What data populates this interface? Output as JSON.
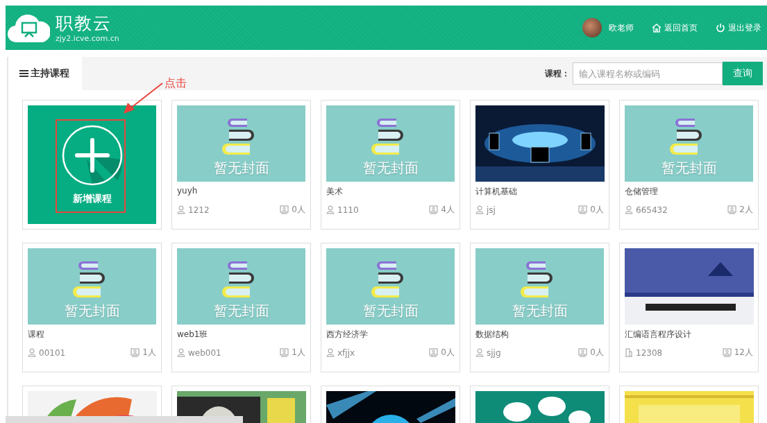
{
  "header": {
    "logo_title": "职教云",
    "logo_subtitle": "zjy2.icve.com.cn",
    "user": "欧老师",
    "links": [
      {
        "kind": "home",
        "label": "返回首页"
      },
      {
        "kind": "logout",
        "label": "退出登录"
      }
    ]
  },
  "tabs": [
    {
      "label": "主持课程",
      "selected": true
    }
  ],
  "search": {
    "label": "课程：",
    "placeholder": "输入课程名称或编码",
    "button": "查询"
  },
  "annotation": {
    "label": "点击"
  },
  "cards": [
    {
      "kind": "add",
      "label": "新增课程"
    },
    {
      "kind": "course",
      "cover": {
        "kind": "placeholder",
        "text": "暂无封面"
      },
      "title": "yuyh",
      "owner": {
        "kind": "person",
        "text": "1212"
      },
      "count": "0人"
    },
    {
      "kind": "course",
      "cover": {
        "kind": "placeholder",
        "text": "暂无封面"
      },
      "title": "美术",
      "owner": {
        "kind": "person",
        "text": "1110"
      },
      "count": "4人"
    },
    {
      "kind": "course",
      "title": "计算机基础",
      "owner": {
        "kind": "person",
        "text": "jsj"
      },
      "count": "0人"
    },
    {
      "kind": "course",
      "cover": {
        "kind": "placeholder",
        "text": "暂无封面"
      },
      "title": "仓储管理",
      "owner": {
        "kind": "person",
        "text": "665432"
      },
      "count": "2人"
    },
    {
      "kind": "course",
      "cover": {
        "kind": "placeholder",
        "text": "暂无封面"
      },
      "title": "课程",
      "owner": {
        "kind": "person",
        "text": "00101"
      },
      "count": "1人"
    },
    {
      "kind": "course",
      "cover": {
        "kind": "placeholder",
        "text": "暂无封面"
      },
      "title": "web1班",
      "owner": {
        "kind": "person",
        "text": "web001"
      },
      "count": "1人"
    },
    {
      "kind": "course",
      "cover": {
        "kind": "placeholder",
        "text": "暂无封面"
      },
      "title": "西方经济学",
      "owner": {
        "kind": "person",
        "text": "xfjjx"
      },
      "count": "0人"
    },
    {
      "kind": "course",
      "cover": {
        "kind": "placeholder",
        "text": "暂无封面"
      },
      "title": "数据结构",
      "owner": {
        "kind": "person",
        "text": "sjjg"
      },
      "count": "0人"
    },
    {
      "kind": "course",
      "title": "汇编语言程序设计",
      "owner": {
        "kind": "building",
        "text": "12308"
      },
      "count": "12人"
    },
    {
      "kind": "course"
    },
    {
      "kind": "course"
    },
    {
      "kind": "course"
    },
    {
      "kind": "course"
    },
    {
      "kind": "course"
    }
  ]
}
